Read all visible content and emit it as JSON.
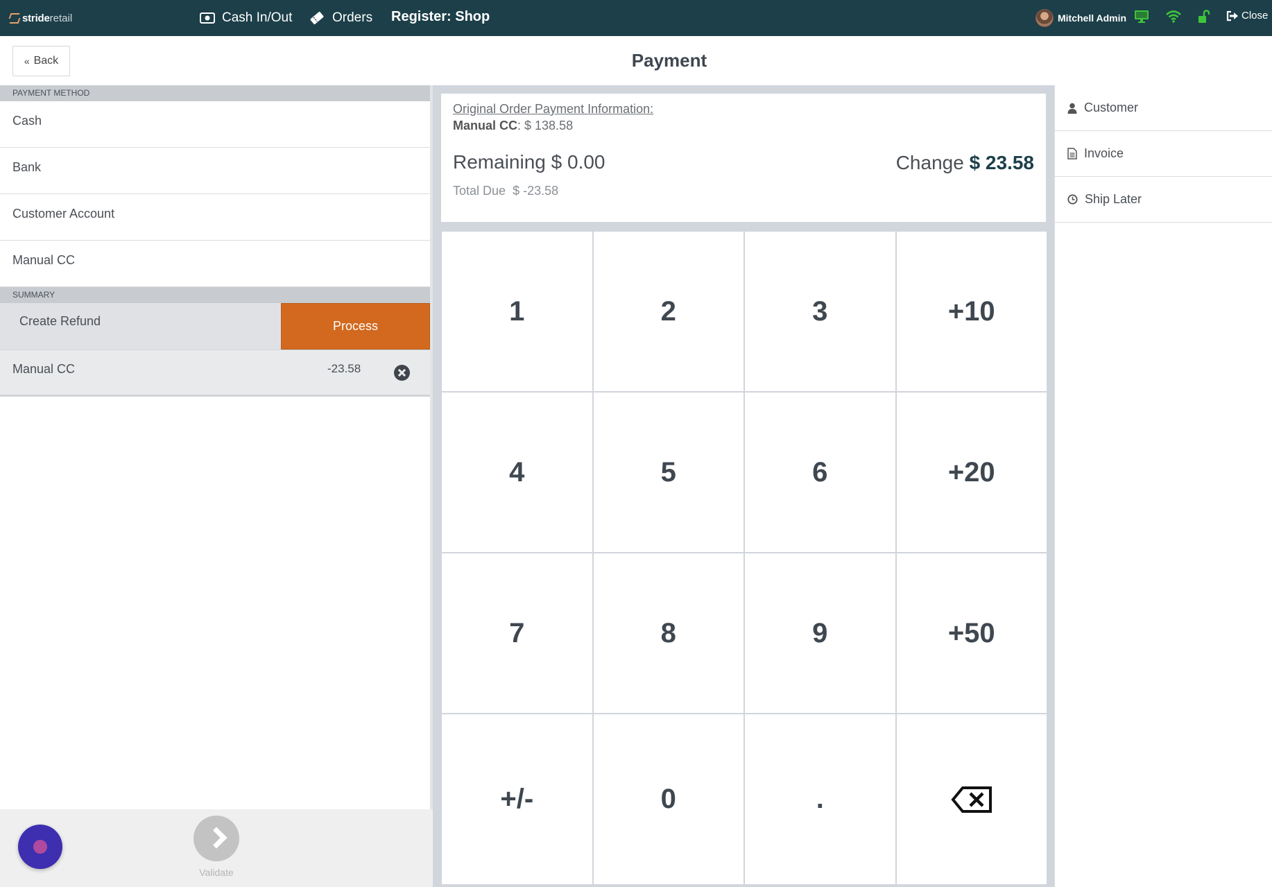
{
  "topbar": {
    "logo_bold": "stride",
    "logo_light": "retail",
    "cash_label": "Cash In/Out",
    "orders_label": "Orders",
    "register_title": "Register: Shop",
    "user_name": "Mitchell Admin",
    "close_label": "Close",
    "status_color": "#3ec43b"
  },
  "header": {
    "back_label": "Back",
    "title": "Payment"
  },
  "left": {
    "payment_method_label": "PAYMENT METHOD",
    "methods": [
      "Cash",
      "Bank",
      "Customer Account",
      "Manual CC"
    ],
    "summary_label": "SUMMARY",
    "create_refund_label": "Create Refund",
    "process_label": "Process",
    "process_color": "#d2691e",
    "payment_line": {
      "method": "Manual CC",
      "amount": "-23.58"
    },
    "validate_label": "Validate"
  },
  "info": {
    "original_title": "Original Order Payment Information:",
    "original_method": "Manual CC",
    "original_amount": ": $ 138.58",
    "remaining_label": "Remaining",
    "remaining_value": "$ 0.00",
    "total_due_label": "Total Due",
    "total_due_value": "$ -23.58",
    "change_label": "Change",
    "change_value": "$ 23.58"
  },
  "numpad": {
    "keys": [
      "1",
      "2",
      "3",
      "+10",
      "4",
      "5",
      "6",
      "+20",
      "7",
      "8",
      "9",
      "+50",
      "+/-",
      "0",
      ".",
      "backspace-icon"
    ]
  },
  "right": {
    "items": [
      "Customer",
      "Invoice",
      "Ship Later"
    ]
  }
}
